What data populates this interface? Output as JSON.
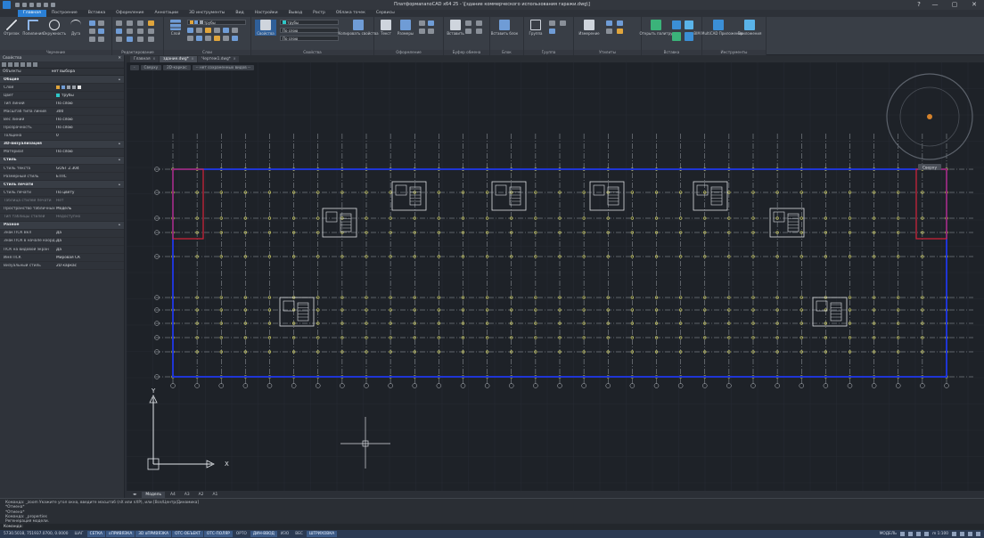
{
  "window": {
    "title": "ПлатформаnanoCAD x64 25 - \\[здание коммерческого использования гаражи.dwg\\]",
    "help": "?",
    "minimize": "—",
    "maximize": "▢",
    "close": "✕"
  },
  "menu": [
    "Главная",
    "Построение",
    "Вставка",
    "Оформление",
    "Аннотации",
    "3D инструменты",
    "Вид",
    "Настройки",
    "Вывод",
    "Растр",
    "Облака точек",
    "Сервисы"
  ],
  "ribbon": {
    "groups": [
      "Черчение",
      "Редактирование",
      "Слои",
      "Свойства",
      "Оформление",
      "Буфер обмена",
      "Блок",
      "Группа",
      "Утилиты",
      "Вставка",
      "Инструменты"
    ],
    "draw": [
      "Отрезок",
      "Полилиния",
      "Окружность",
      "Дуга"
    ],
    "layers_btn": "Слой",
    "layer_value": "трубы",
    "props_btn": "Свойства",
    "color_value": "трубы",
    "linetype_value": "По слою",
    "lineweight_value": "По слою",
    "copy_props": "Копировать свойства",
    "text_btn": "Текст",
    "dim_btn": "Размеры",
    "insert_btn": "Вставить",
    "block_btn": "Вставить блок",
    "group_btn": "Группа",
    "measure_btn": "Измерение",
    "util1": "Открыть палитру",
    "util2": "BIM-Моделирование",
    "tool1": "BIM MultiCAD Приложение",
    "tool2": "Приложения"
  },
  "properties": {
    "title": "Свойства",
    "object": {
      "key": "Объекты",
      "value": "нет выбора"
    },
    "rows": [
      {
        "k": "Общие",
        "sec": true
      },
      {
        "k": "Слой",
        "v": "трубы",
        "icons": true
      },
      {
        "k": "Цвет",
        "v": "трубы",
        "swatch": "#2ec7c7"
      },
      {
        "k": "Тип линий",
        "v": "По слою"
      },
      {
        "k": "Масштаб типа линий",
        "v": "300"
      },
      {
        "k": "Вес линий",
        "v": "По слою"
      },
      {
        "k": "Прозрачность",
        "v": "По слою"
      },
      {
        "k": "Толщина",
        "v": "0"
      },
      {
        "k": "3D-визуализация",
        "sec": true
      },
      {
        "k": "Материал",
        "v": "По слою"
      },
      {
        "k": "Стиль",
        "sec": true
      },
      {
        "k": "Стиль текста",
        "v": "GOST 2.304"
      },
      {
        "k": "Размерный стиль",
        "v": "ЕТПС"
      },
      {
        "k": "Стиль печати",
        "sec": true
      },
      {
        "k": "Стиль печати",
        "v": "По цвету"
      },
      {
        "k": "Таблица стилей печати",
        "v": "Нет",
        "dis": true
      },
      {
        "k": "Пространство табличных стилей",
        "v": "Модель"
      },
      {
        "k": "Тип таблицы стилей",
        "v": "Недоступно",
        "dis": true
      },
      {
        "k": "Разное",
        "sec": true
      },
      {
        "k": "Знак ПСК Вкл",
        "v": "Да"
      },
      {
        "k": "Знак ПСК в начале коорд.",
        "v": "Да"
      },
      {
        "k": "ПСК на видовой экран",
        "v": "Да"
      },
      {
        "k": "Имя ПСК",
        "v": "Мировая СК"
      },
      {
        "k": "Визуальный стиль",
        "v": "2D каркас"
      }
    ]
  },
  "doc_tabs": [
    "Главная"
  ],
  "doc_tabs_open": [
    {
      "label": "здание.dwg*",
      "active": true
    },
    {
      "label": "Чертеж1.dwg*",
      "active": false
    }
  ],
  "doc_tab_close": "x",
  "view_controls": [
    "-",
    "Сверху",
    "2D-каркас",
    "-- нет сохраненных видов --"
  ],
  "drawing": {
    "viewcube_label": "Сверху",
    "ucs_x": "X",
    "ucs_y": "Y",
    "outline_color": "#1f35d6",
    "accent_color": "#d4233a",
    "grid_color": "#c9c95a"
  },
  "layout_tabs": [
    "Модель",
    "A4",
    "A3",
    "A2",
    "A1"
  ],
  "command_history": [
    "Команда: _zoom Укажите угол окна, введите масштаб (nX или nXP), или [Все/Центр/Динамика]",
    "*Отмена*",
    "*Отмена*",
    "Команда: _properties",
    "Регенерация модели."
  ],
  "command_prompt": "Команда:",
  "status": {
    "coords": "5730.5018, 751937.0700, 0.0000",
    "buttons": [
      {
        "label": "ШАГ",
        "on": false
      },
      {
        "label": "СЕТКА",
        "on": true
      },
      {
        "label": "оПРИВЯЗКА",
        "on": true
      },
      {
        "label": "3D оПРИВЯЗКА",
        "on": true
      },
      {
        "label": "ОТС-ОБЪЕКТ",
        "on": true
      },
      {
        "label": "ОТС-ПОЛЯР",
        "on": true
      },
      {
        "label": "ОРТО",
        "on": false
      },
      {
        "label": "ДИН-ВВОД",
        "on": true
      },
      {
        "label": "ИЗО",
        "on": false
      },
      {
        "label": "ВЕС",
        "on": false
      },
      {
        "label": "ШТРИХОВКА",
        "on": true
      }
    ],
    "model": "МОДЕЛЬ",
    "scale": "m 1:100"
  }
}
